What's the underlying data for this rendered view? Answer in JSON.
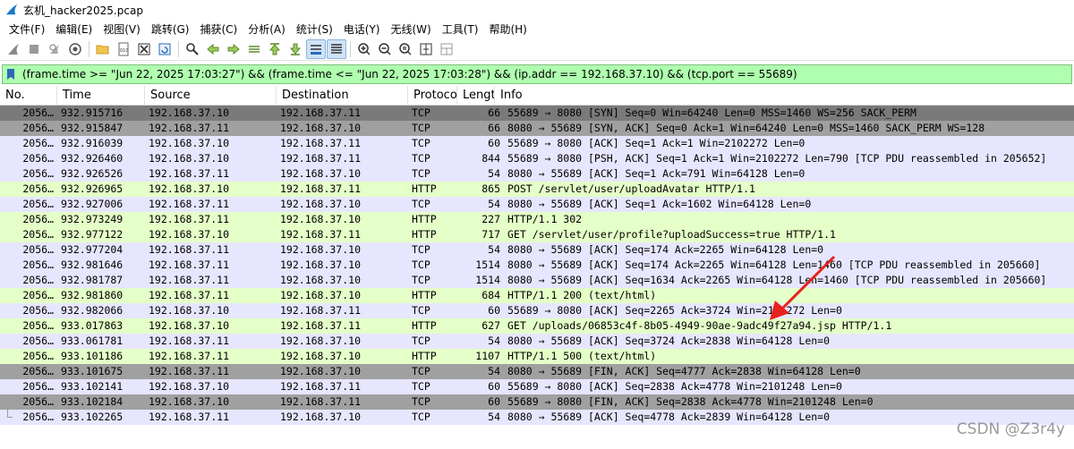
{
  "window": {
    "title": "玄机_hacker2025.pcap"
  },
  "menu": [
    "文件(F)",
    "编辑(E)",
    "视图(V)",
    "跳转(G)",
    "捕获(C)",
    "分析(A)",
    "统计(S)",
    "电话(Y)",
    "无线(W)",
    "工具(T)",
    "帮助(H)"
  ],
  "toolbar_icons": [
    "start-capture-icon",
    "stop-capture-icon",
    "restart-capture-icon",
    "capture-options-icon",
    "open-file-icon",
    "save-file-icon",
    "close-file-icon",
    "reload-file-icon",
    "find-packet-icon",
    "go-back-icon",
    "go-forward-icon",
    "go-to-packet-icon",
    "go-first-icon",
    "go-last-icon",
    "auto-scroll-icon",
    "colorize-icon",
    "zoom-in-icon",
    "zoom-out-icon",
    "zoom-normal-icon",
    "resize-columns-icon",
    "layout-icon"
  ],
  "filter": {
    "text": "(frame.time >= \"Jun 22, 2025 17:03:27\") && (frame.time <= \"Jun 22, 2025 17:03:28\") && (ip.addr == 192.168.37.10) && (tcp.port == 55689)"
  },
  "columns": {
    "no": "No.",
    "time": "Time",
    "source": "Source",
    "destination": "Destination",
    "protocol": "Protoco",
    "length": "Lengt",
    "info": "Info"
  },
  "packets": [
    {
      "no": "2056…",
      "time": "932.915716",
      "src": "192.168.37.10",
      "dst": "192.168.37.11",
      "proto": "TCP",
      "len": "66",
      "info": "55689 → 8080 [SYN] Seq=0 Win=64240 Len=0 MSS=1460 WS=256 SACK_PERM",
      "style": "sel"
    },
    {
      "no": "2056…",
      "time": "932.915847",
      "src": "192.168.37.11",
      "dst": "192.168.37.10",
      "proto": "TCP",
      "len": "66",
      "info": "8080 → 55689 [SYN, ACK] Seq=0 Ack=1 Win=64240 Len=0 MSS=1460 SACK_PERM WS=128",
      "style": "flag"
    },
    {
      "no": "2056…",
      "time": "932.916039",
      "src": "192.168.37.10",
      "dst": "192.168.37.11",
      "proto": "TCP",
      "len": "60",
      "info": "55689 → 8080 [ACK] Seq=1 Ack=1 Win=2102272 Len=0",
      "style": "tcp"
    },
    {
      "no": "2056…",
      "time": "932.926460",
      "src": "192.168.37.10",
      "dst": "192.168.37.11",
      "proto": "TCP",
      "len": "844",
      "info": "55689 → 8080 [PSH, ACK] Seq=1 Ack=1 Win=2102272 Len=790 [TCP PDU reassembled in 205652]",
      "style": "tcp"
    },
    {
      "no": "2056…",
      "time": "932.926526",
      "src": "192.168.37.11",
      "dst": "192.168.37.10",
      "proto": "TCP",
      "len": "54",
      "info": "8080 → 55689 [ACK] Seq=1 Ack=791 Win=64128 Len=0",
      "style": "tcp"
    },
    {
      "no": "2056…",
      "time": "932.926965",
      "src": "192.168.37.10",
      "dst": "192.168.37.11",
      "proto": "HTTP",
      "len": "865",
      "info": "POST /servlet/user/uploadAvatar HTTP/1.1",
      "style": "http"
    },
    {
      "no": "2056…",
      "time": "932.927006",
      "src": "192.168.37.11",
      "dst": "192.168.37.10",
      "proto": "TCP",
      "len": "54",
      "info": "8080 → 55689 [ACK] Seq=1 Ack=1602 Win=64128 Len=0",
      "style": "tcp"
    },
    {
      "no": "2056…",
      "time": "932.973249",
      "src": "192.168.37.11",
      "dst": "192.168.37.10",
      "proto": "HTTP",
      "len": "227",
      "info": "HTTP/1.1 302",
      "style": "http"
    },
    {
      "no": "2056…",
      "time": "932.977122",
      "src": "192.168.37.10",
      "dst": "192.168.37.11",
      "proto": "HTTP",
      "len": "717",
      "info": "GET /servlet/user/profile?uploadSuccess=true HTTP/1.1",
      "style": "http"
    },
    {
      "no": "2056…",
      "time": "932.977204",
      "src": "192.168.37.11",
      "dst": "192.168.37.10",
      "proto": "TCP",
      "len": "54",
      "info": "8080 → 55689 [ACK] Seq=174 Ack=2265 Win=64128 Len=0",
      "style": "tcp"
    },
    {
      "no": "2056…",
      "time": "932.981646",
      "src": "192.168.37.11",
      "dst": "192.168.37.10",
      "proto": "TCP",
      "len": "1514",
      "info": "8080 → 55689 [ACK] Seq=174 Ack=2265 Win=64128 Len=1460 [TCP PDU reassembled in 205660]",
      "style": "tcp"
    },
    {
      "no": "2056…",
      "time": "932.981787",
      "src": "192.168.37.11",
      "dst": "192.168.37.10",
      "proto": "TCP",
      "len": "1514",
      "info": "8080 → 55689 [ACK] Seq=1634 Ack=2265 Win=64128 Len=1460 [TCP PDU reassembled in 205660]",
      "style": "tcp"
    },
    {
      "no": "2056…",
      "time": "932.981860",
      "src": "192.168.37.11",
      "dst": "192.168.37.10",
      "proto": "HTTP",
      "len": "684",
      "info": "HTTP/1.1 200   (text/html)",
      "style": "http"
    },
    {
      "no": "2056…",
      "time": "932.982066",
      "src": "192.168.37.10",
      "dst": "192.168.37.11",
      "proto": "TCP",
      "len": "60",
      "info": "55689 → 8080 [ACK] Seq=2265 Ack=3724 Win=2101272 Len=0",
      "style": "tcp"
    },
    {
      "no": "2056…",
      "time": "933.017863",
      "src": "192.168.37.10",
      "dst": "192.168.37.11",
      "proto": "HTTP",
      "len": "627",
      "info": "GET /uploads/06853c4f-8b05-4949-90ae-9adc49f27a94.jsp HTTP/1.1",
      "style": "http"
    },
    {
      "no": "2056…",
      "time": "933.061781",
      "src": "192.168.37.11",
      "dst": "192.168.37.10",
      "proto": "TCP",
      "len": "54",
      "info": "8080 → 55689 [ACK] Seq=3724 Ack=2838 Win=64128 Len=0",
      "style": "tcp"
    },
    {
      "no": "2056…",
      "time": "933.101186",
      "src": "192.168.37.11",
      "dst": "192.168.37.10",
      "proto": "HTTP",
      "len": "1107",
      "info": "HTTP/1.1 500   (text/html)",
      "style": "http"
    },
    {
      "no": "2056…",
      "time": "933.101675",
      "src": "192.168.37.11",
      "dst": "192.168.37.10",
      "proto": "TCP",
      "len": "54",
      "info": "8080 → 55689 [FIN, ACK] Seq=4777 Ack=2838 Win=64128 Len=0",
      "style": "flag"
    },
    {
      "no": "2056…",
      "time": "933.102141",
      "src": "192.168.37.10",
      "dst": "192.168.37.11",
      "proto": "TCP",
      "len": "60",
      "info": "55689 → 8080 [ACK] Seq=2838 Ack=4778 Win=2101248 Len=0",
      "style": "tcp"
    },
    {
      "no": "2056…",
      "time": "933.102184",
      "src": "192.168.37.10",
      "dst": "192.168.37.11",
      "proto": "TCP",
      "len": "60",
      "info": "55689 → 8080 [FIN, ACK] Seq=2838 Ack=4778 Win=2101248 Len=0",
      "style": "flag"
    },
    {
      "no": "2056…",
      "time": "933.102265",
      "src": "192.168.37.11",
      "dst": "192.168.37.10",
      "proto": "TCP",
      "len": "54",
      "info": "8080 → 55689 [ACK] Seq=4778 Ack=2839 Win=64128 Len=0",
      "style": "tcp"
    }
  ],
  "annotation": {
    "color": "#e8221c"
  },
  "watermark": "CSDN @Z3r4y"
}
